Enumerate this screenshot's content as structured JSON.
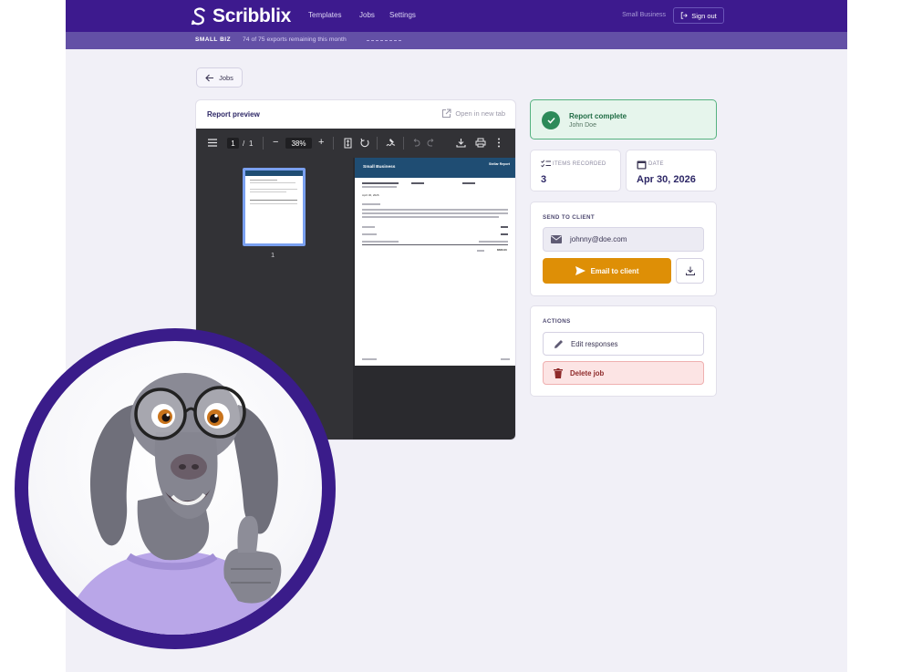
{
  "nav": {
    "logo": "Scribblix",
    "links": [
      "Templates",
      "Jobs",
      "Settings"
    ],
    "plan": "Small Business",
    "signout": "Sign out"
  },
  "subbar": {
    "plan_badge": "SMALL BIZ",
    "exports": "74 of 75 exports remaining this month",
    "exports_remaining": 74,
    "exports_total": 75
  },
  "back": {
    "label": "Jobs"
  },
  "preview": {
    "title": "Report preview",
    "open_new_tab": "Open in new tab",
    "viewer": {
      "page_current": "1",
      "page_sep": "/",
      "page_total": "1",
      "zoom": "38%",
      "thumb_label": "1"
    },
    "doc": {
      "brand": "Small Business",
      "report_title": "Stellar Report",
      "date_line": "April 30, 2026",
      "total": "$580.00"
    }
  },
  "status": {
    "title": "Report complete",
    "client": "John Doe"
  },
  "stats": {
    "items_label": "ITEMS RECORDED",
    "items_value": "3",
    "date_label": "DATE",
    "date_value": "Apr 30, 2026"
  },
  "send": {
    "label": "SEND TO CLIENT",
    "email": "johnny@doe.com",
    "email_button": "Email to client"
  },
  "actions": {
    "label": "ACTIONS",
    "edit": "Edit responses",
    "delete": "Delete job"
  },
  "colors": {
    "nav": "#3d1a8e",
    "subbar": "#6350a6",
    "accent": "#de8f06",
    "success": "#2d8a59",
    "danger": "#8e2a2a"
  },
  "icons": [
    "scribblix-logo-icon",
    "sign-out-icon",
    "arrow-left-icon",
    "external-link-icon",
    "menu-icon",
    "fit-page-icon",
    "rotate-icon",
    "annotate-icon",
    "undo-icon",
    "redo-icon",
    "download-icon",
    "print-icon",
    "more-icon",
    "check-icon",
    "checklist-icon",
    "calendar-icon",
    "mail-icon",
    "send-icon",
    "pencil-icon",
    "trash-icon"
  ]
}
